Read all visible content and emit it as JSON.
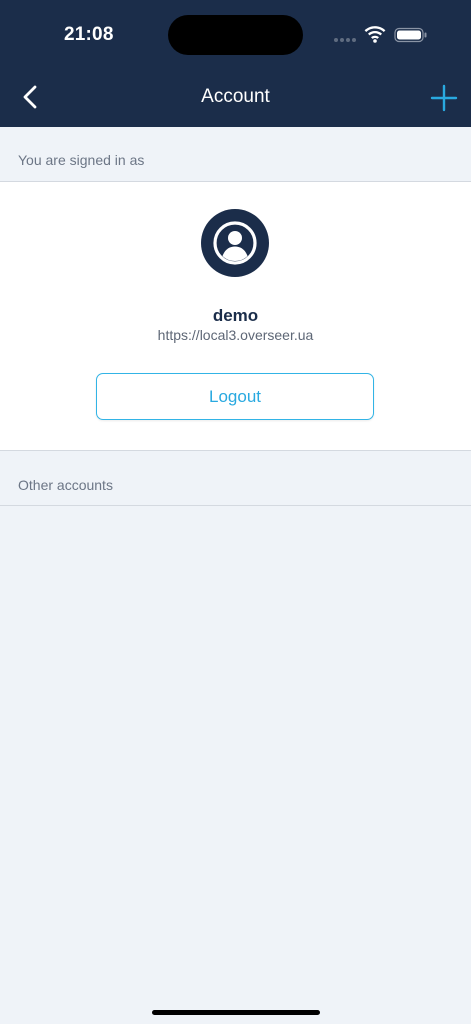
{
  "status_bar": {
    "time": "21:08"
  },
  "nav": {
    "title": "Account",
    "back_icon": "chevron-left-icon",
    "add_icon": "plus-icon"
  },
  "signed_in": {
    "section_label": "You are signed in as",
    "avatar_icon": "user-avatar-icon",
    "username": "demo",
    "server": "https://local3.overseer.ua",
    "logout_label": "Logout"
  },
  "other_accounts": {
    "section_label": "Other accounts"
  },
  "colors": {
    "header_bg": "#1b2d4a",
    "accent": "#29a9e0",
    "page_bg": "#eff3f8"
  }
}
